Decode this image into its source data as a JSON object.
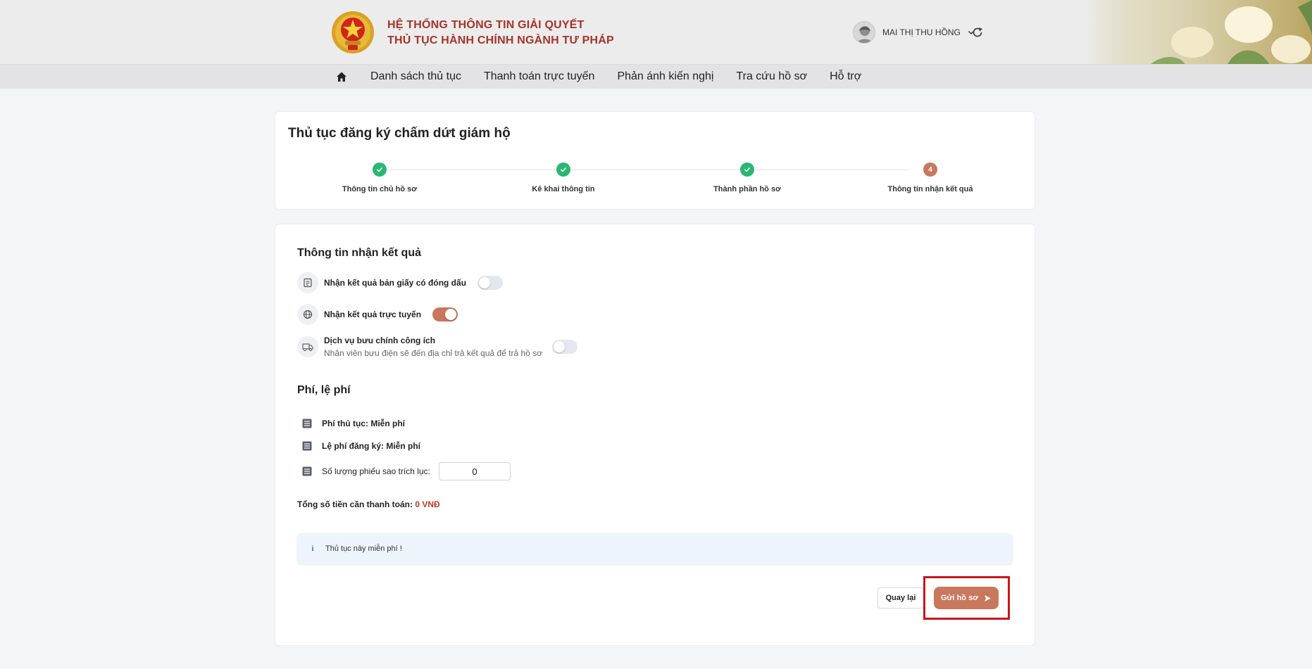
{
  "header": {
    "brand_line1": "HỆ THỐNG THÔNG TIN GIẢI QUYẾT",
    "brand_line2": "THỦ TỤC HÀNH CHÍNH NGÀNH TƯ PHÁP",
    "user_name": "MAI THỊ THU HỒNG"
  },
  "nav": {
    "items": [
      {
        "label": "Danh sách thủ tục"
      },
      {
        "label": "Thanh toán trực tuyến"
      },
      {
        "label": "Phản ánh kiến nghị"
      },
      {
        "label": "Tra cứu hồ sơ"
      },
      {
        "label": "Hỗ trợ"
      }
    ]
  },
  "procedure": {
    "title": "Thủ tục đăng ký chấm dứt giám hộ",
    "steps": [
      {
        "label": "Thông tin chủ hồ sơ",
        "status": "done"
      },
      {
        "label": "Kê khai thông tin",
        "status": "done"
      },
      {
        "label": "Thành phần hồ sơ",
        "status": "done"
      },
      {
        "label": "Thông tin nhận kết quả",
        "status": "current",
        "number": "4"
      }
    ]
  },
  "result": {
    "section_title": "Thông tin nhận kết quả",
    "options": [
      {
        "label": "Nhận kết quả bản giấy có đóng dấu",
        "enabled": false
      },
      {
        "label": "Nhận kết quả trực tuyến",
        "enabled": true
      },
      {
        "label": "Dịch vụ bưu chính công ích",
        "sub": "Nhân viên bưu điện sẽ đến địa chỉ trả kết quả để trả hồ sơ",
        "enabled": false
      }
    ]
  },
  "fees": {
    "section_title": "Phí, lệ phí",
    "procedure_fee": "Phí thủ tục: Miễn phí",
    "registration_fee": "Lệ phí đăng ký: Miễn phí",
    "copies_label": "Số lượng phiếu sao trích lục:",
    "copies_value": "0",
    "total_label": "Tổng số tiền cần thanh toán:",
    "total_amount": "0 VNĐ"
  },
  "notice": {
    "icon": "i",
    "text": "Thủ tục này miễn phí !"
  },
  "actions": {
    "back_label": "Quay lại",
    "submit_label": "Gửi hồ sơ"
  },
  "colors": {
    "brand_red": "#a5342a",
    "accent": "#c9775d",
    "done_green": "#2bb673",
    "highlight_border": "#c8161d"
  }
}
